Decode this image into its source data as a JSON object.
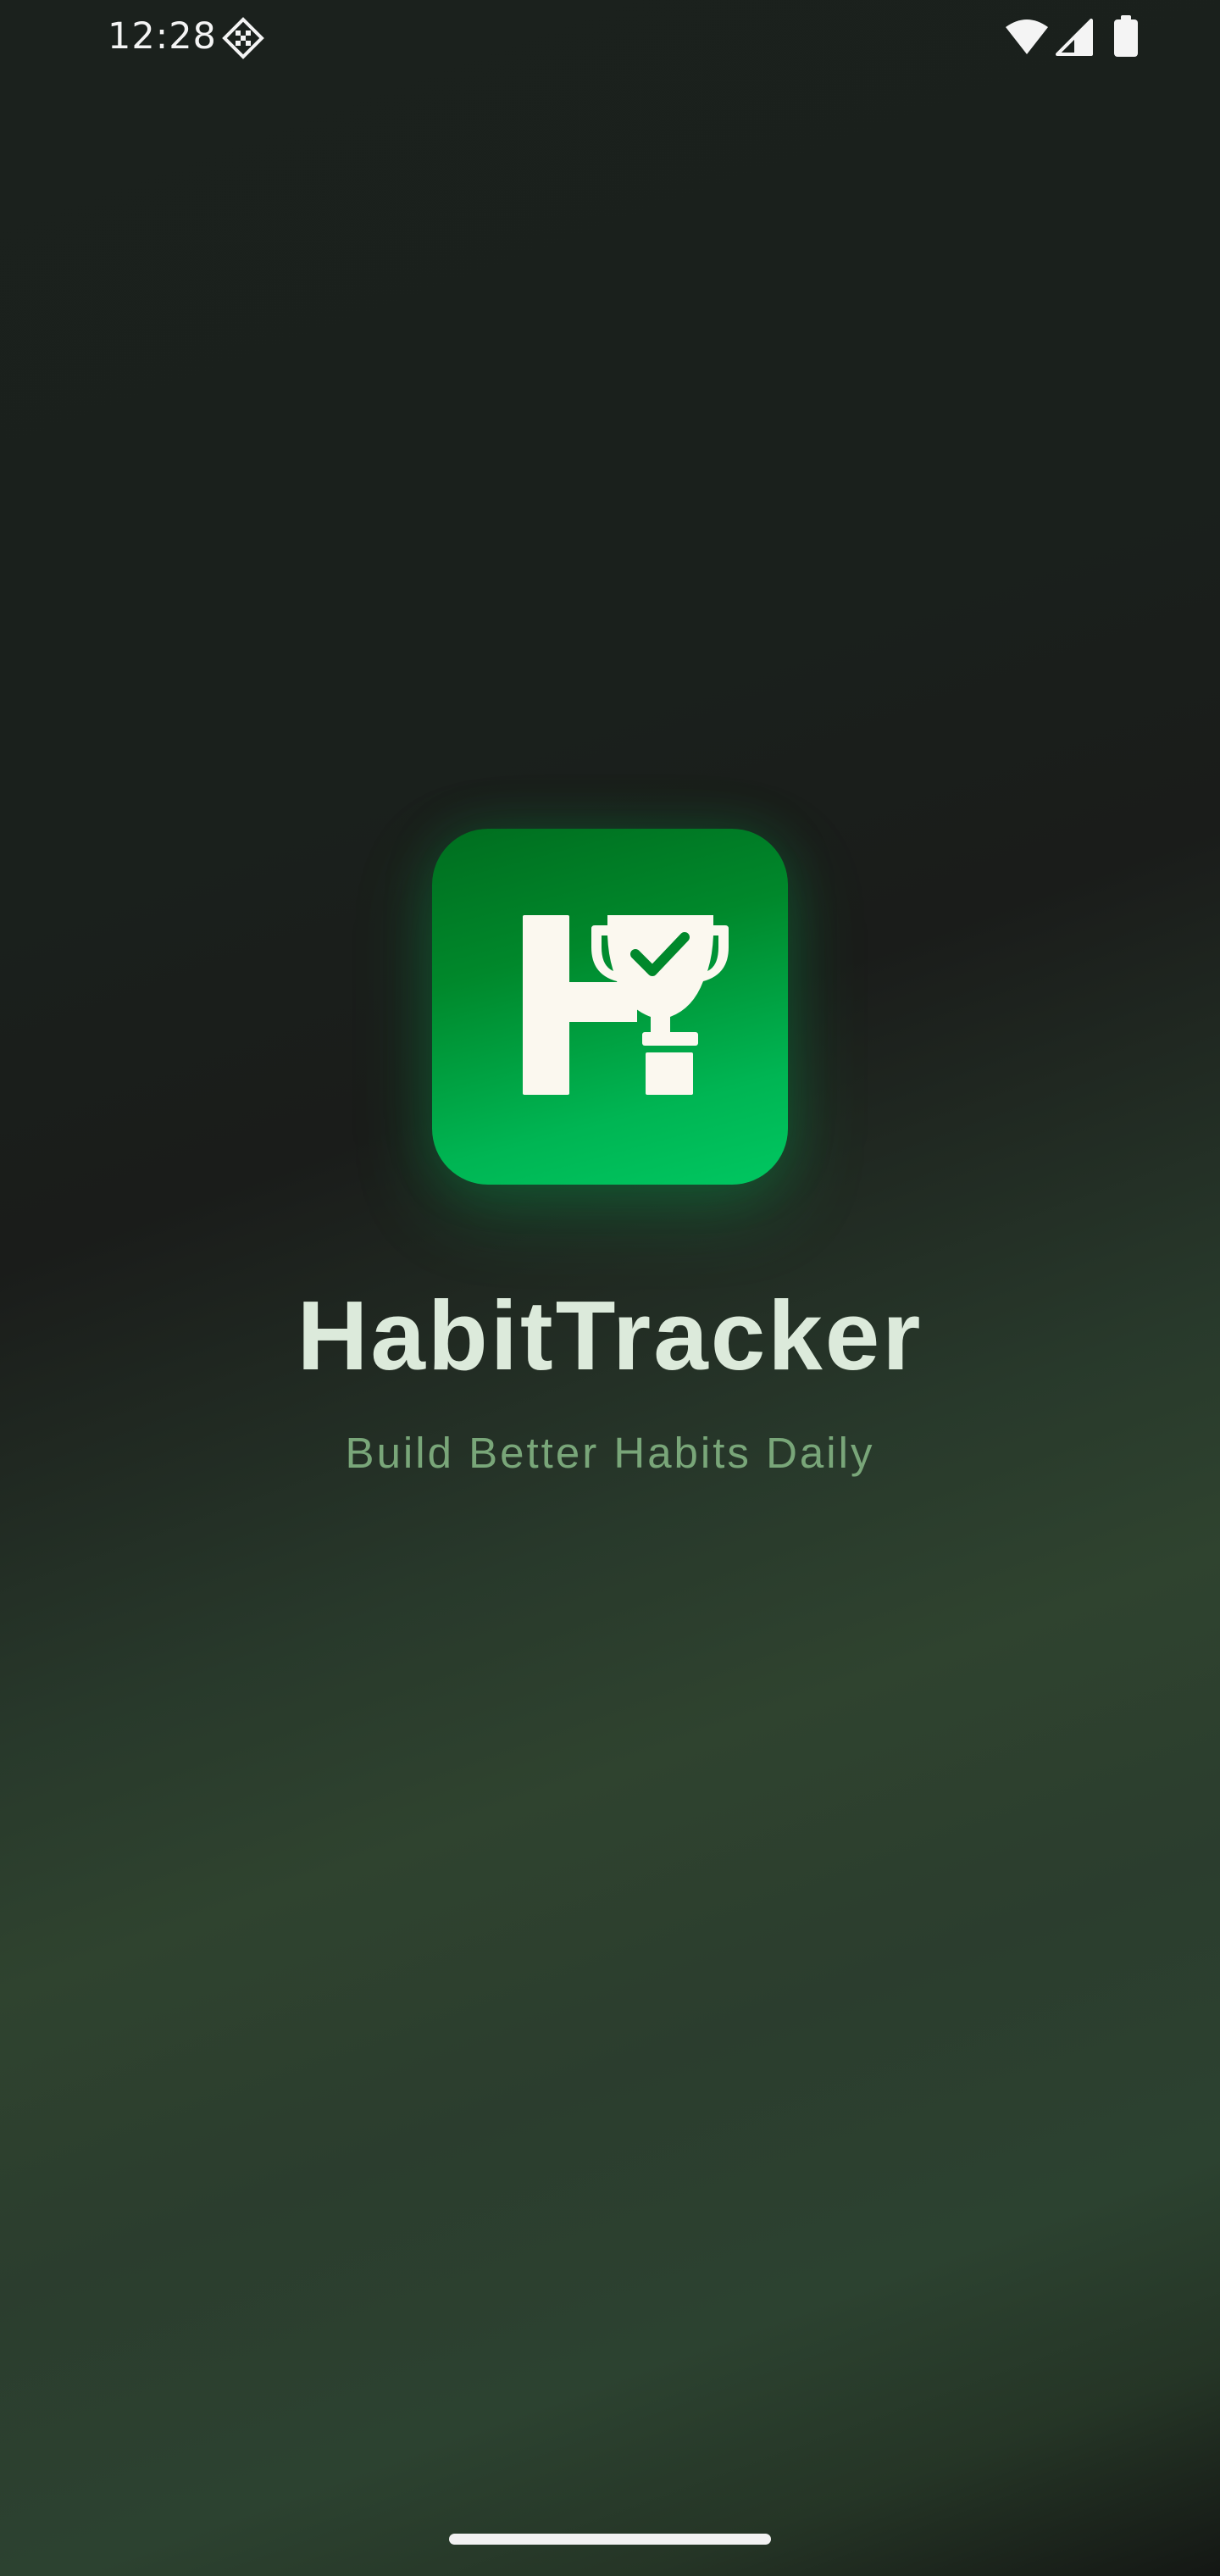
{
  "status_bar": {
    "time": "12:28",
    "left_icon": "network-diamond-icon",
    "wifi_icon": "wifi-icon",
    "signal_icon": "cellular-signal-icon",
    "battery_icon": "battery-icon"
  },
  "splash": {
    "app_icon": "habittracker-logo-icon",
    "title": "HabitTracker",
    "subtitle": "Build Better Habits Daily"
  },
  "colors": {
    "icon_gradient_top": "#006e1f",
    "icon_gradient_bottom": "#00c761",
    "title": "#dceadb",
    "subtitle": "#79a679",
    "background_dark": "#1a1c1a",
    "background_green": "#2f432f"
  }
}
